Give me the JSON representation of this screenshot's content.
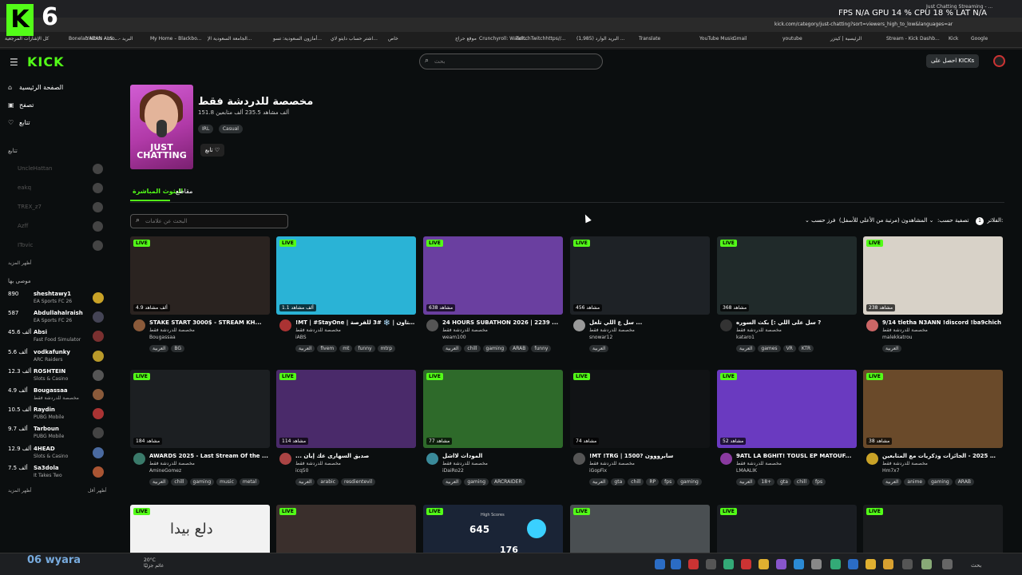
{
  "overlay": {
    "k_logo": "K",
    "counter": "6"
  },
  "perf": "FPS N/A   GPU 14 %   CPU 18 %   LAT N/A",
  "browser": {
    "tab_title": "Just Chatting Streaming - ...",
    "url": "kick.com/category/just-chatting?sort=viewers_high_to_low&languages=ar",
    "bookmarks": [
      "كل الإشارات المرجعية",
      "Bonelab Mods - mo...",
      "YAZAN ALS... - البريد",
      "My Home – Blackbo...",
      "الجامعة السعودية الإ...",
      "أمازون السعودية: تسو...",
      "اشتر حساب دايتو لاي...",
      "خاص",
      "موقع حراج",
      "Crunchyroll: Watch...",
      "TwitchTwitchhttps//...",
      "البريد الوارد (1,985) ...",
      "Translate",
      "YouTube Music",
      "Gmail",
      "youtube",
      "الرئيسية | كيتزر",
      "Stream - Kick Dashb...",
      "Kick",
      "Google"
    ]
  },
  "header": {
    "logo": "KICK",
    "search_placeholder": "بحث",
    "get_kicks": "احصل على KICKs"
  },
  "sidebar": {
    "nav": [
      {
        "label": "الصفحة الرئيسية",
        "icon": "home-icon"
      },
      {
        "label": "تصفح",
        "icon": "browse-icon"
      },
      {
        "label": "تتابع",
        "icon": "heart-icon"
      }
    ],
    "following_header": "تتابع",
    "offline": [
      "UncleHattan",
      "eakq",
      "TREX_z7",
      "Azff",
      "ITovic"
    ],
    "show_more_1": "أظهر المزيد",
    "recommended_header": "موصى بها",
    "channels": [
      {
        "count": "890",
        "name": "sheshtawy1",
        "category": "EA Sports FC 26",
        "color": "#c9a227"
      },
      {
        "count": "587",
        "name": "Abdullahalraish",
        "category": "EA Sports FC 26",
        "color": "#445"
      },
      {
        "count": "45.6 ألف",
        "name": "Absi",
        "category": "Fast Food Simulator",
        "color": "#7a3030"
      },
      {
        "count": "5.6 ألف",
        "name": "vodkafunky",
        "category": "ARC Raiders",
        "color": "#b99a2a"
      },
      {
        "count": "12.3 ألف",
        "name": "ROSHTEIN",
        "category": "Slots & Casino",
        "color": "#555"
      },
      {
        "count": "4.9 ألف",
        "name": "Bougassaa",
        "category": "مخصصة للدردشة فقط",
        "color": "#8a5a3a"
      },
      {
        "count": "10.5 ألف",
        "name": "Raydin",
        "category": "PUBG Mobile",
        "color": "#a33"
      },
      {
        "count": "9.7 ألف",
        "name": "Tarboun",
        "category": "PUBG Mobile",
        "color": "#444"
      },
      {
        "count": "12.9 ألف",
        "name": "4HEAD",
        "category": "Slots & Casino",
        "color": "#4a6aa0"
      },
      {
        "count": "7.5 ألف",
        "name": "Sa3dola",
        "category": "It Takes Two",
        "color": "#aa5533"
      }
    ],
    "show_more_2": "أظهر المزيد",
    "show_less": "أظهر أقل"
  },
  "category": {
    "image_text": "JUST CHATTING",
    "title": "مخصصة للدردشة فقط",
    "stats": "151.8 ألف مشاهد 235.5 ألف متابعين",
    "tags": [
      "IRL",
      "Casual"
    ],
    "follow": "تابع"
  },
  "tabs": {
    "live": "البثوث المباشرة",
    "clips": "مقاطع"
  },
  "filter": {
    "tag_search_placeholder": "البحث عن علامات",
    "filters_label": "الفلاتر",
    "filters_count": "1",
    "sort_label": "تصفية حسب:",
    "sort_value": "المشاهدون (مرتبة من الأعلى للأسفل)",
    "sort_by": "فرز حسب:"
  },
  "streams": [
    {
      "viewers": "4.9 ألف مشاهد",
      "title": "STAKE START 3000$ - STREAM KH...",
      "category": "مخصصة للدردشة فقط",
      "user": "Bougassaa",
      "tags": [
        "العربية",
        "BG"
      ],
      "bg": "#2a2320",
      "av": "#8a5a3a"
    },
    {
      "viewers": "1.1 ألف مشاهد",
      "title": "!MT | #StayOne | إستاون | ❄️ #3 للفرصة ...",
      "category": "مخصصة للدردشة فقط",
      "user": "iABS",
      "tags": [
        "العربية",
        "fivem",
        "mt",
        "funny",
        "mtrp"
      ],
      "bg": "#2ab3d6",
      "av": "#a33"
    },
    {
      "viewers": "638 مشاهد",
      "title": "24 HOURS SUBATHON 2026 | 2239 ...",
      "category": "مخصصة للدردشة فقط",
      "user": "weam100",
      "tags": [
        "العربية",
        "chill",
        "gaming",
        "ARAB",
        "funny"
      ],
      "bg": "#6a3fa0",
      "av": "#555"
    },
    {
      "viewers": "456 مشاهد",
      "title": "سل ع اللي تلعل ...",
      "category": "مخصصة للدردشة فقط",
      "user": "snowar12",
      "tags": [
        "العربية"
      ],
      "bg": "#1e2226",
      "av": "#999"
    },
    {
      "viewers": "368 مشاهد",
      "title": "سل على اللي :] بكث السوره ?",
      "category": "مخصصة للدردشة فقط",
      "user": "kataro1",
      "tags": [
        "العربية",
        "games",
        "VR",
        "KTR"
      ],
      "bg": "#202a2a",
      "av": "#333"
    },
    {
      "viewers": "238 مشاهد",
      "title": "9/14 tletha N3ANN !discord !ba9chich",
      "category": "مخصصة للدردشة فقط",
      "user": "malekkatrou",
      "tags": [
        "العربية"
      ],
      "bg": "#d8d2c8",
      "av": "#c66"
    },
    {
      "viewers": "184 مشاهد",
      "title": "AWARDS 2025 - Last Stream Of the ...",
      "category": "مخصصة للدردشة فقط",
      "user": "AmineGomez",
      "tags": [
        "العربية",
        "chill",
        "gaming",
        "music",
        "metal"
      ],
      "bg": "#1c1f22",
      "av": "#3a7a6a"
    },
    {
      "viewers": "114 مشاهد",
      "title": "... صديق السهارى عك إيان",
      "category": "مخصصة للدردشة فقط",
      "user": "icq50",
      "tags": [
        "العربية",
        "arabic",
        "resdientevil"
      ],
      "bg": "#4a2a6a",
      "av": "#a44"
    },
    {
      "viewers": "77 مشاهد",
      "title": "الموداث لااشل",
      "category": "مخصصة للدردشة فقط",
      "user": "iDaiRo22",
      "tags": [
        "العربية",
        "gaming",
        "ARCRAIDER"
      ],
      "bg": "#2e6a2a",
      "av": "#3a8a9a"
    },
    {
      "viewers": "74 مشاهد",
      "title": "!MT !TRG | 1500? سابرووون",
      "category": "مخصصة للدردشة فقط",
      "user": "iGopFix",
      "tags": [
        "العربية",
        "gta",
        "chill",
        "RP",
        "fps",
        "gaming"
      ],
      "bg": "#111315",
      "av": "#555"
    },
    {
      "viewers": "52 مشاهد",
      "title": "9ATL LA BGHIT! TOUSL EP MATOUF...",
      "category": "مخصصة للدردشة فقط",
      "user": "LMAALIK",
      "tags": [
        "العربية",
        "18+",
        "gta",
        "chill",
        "fps"
      ],
      "bg": "#6a3ac0",
      "av": "#8a3aa0"
    },
    {
      "viewers": "38 مشاهد",
      "title": "ريلايف 2025 - الجائزات وذكريات مع المتابعين 🤝",
      "category": "مخصصة للدردشة فقط",
      "user": "Hm7x7",
      "tags": [
        "العربية",
        "anime",
        "gaming",
        "ARAB"
      ],
      "bg": "#6a4a2a",
      "av": "#c9a227"
    }
  ],
  "row3": [
    {
      "bg": "#f2f2f2"
    },
    {
      "bg": "#3a2f2c"
    },
    {
      "bg": "#1a2436"
    },
    {
      "bg": "#4a4f52"
    },
    {
      "bg": "#1a1d22"
    },
    {
      "bg": "#1a1c1e"
    }
  ],
  "row3_text": {
    "card1": "دلع بيدا",
    "card3_top": "645",
    "card3_bottom": "176",
    "card3_label": "High Scores"
  },
  "taskbar": {
    "user": "06 wyara",
    "weather_temp": "20°C",
    "weather_text": "غائم جزئيًا",
    "search": "بحث"
  }
}
